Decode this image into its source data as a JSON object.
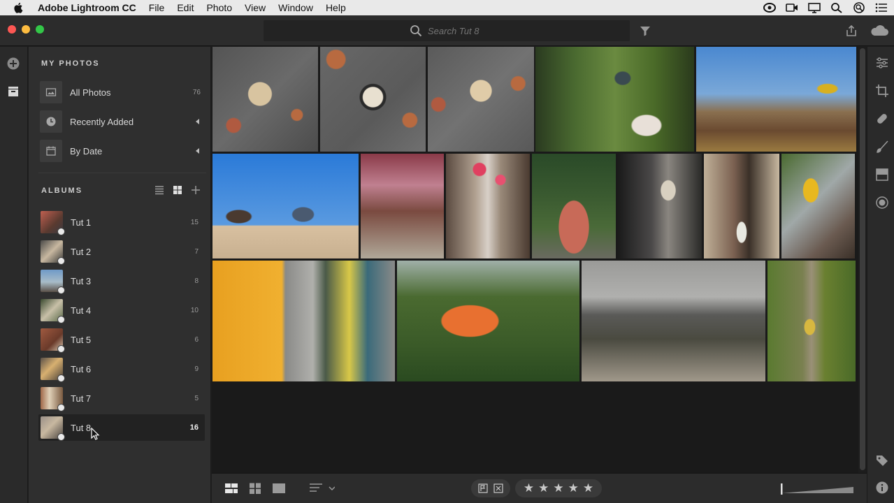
{
  "menubar": {
    "app_name": "Adobe Lightroom CC",
    "items": [
      "File",
      "Edit",
      "Photo",
      "View",
      "Window",
      "Help"
    ]
  },
  "search": {
    "placeholder": "Search Tut 8"
  },
  "sidebar": {
    "my_photos_title": "MY PHOTOS",
    "photos": [
      {
        "label": "All Photos",
        "count": "76",
        "icon": "image-icon"
      },
      {
        "label": "Recently Added",
        "count": "",
        "icon": "clock-icon"
      },
      {
        "label": "By Date",
        "count": "",
        "icon": "calendar-icon"
      }
    ],
    "albums_title": "ALBUMS",
    "albums": [
      {
        "label": "Tut 1",
        "count": "15",
        "color": "#8a5040"
      },
      {
        "label": "Tut 2",
        "count": "7",
        "color": "#6a6a68"
      },
      {
        "label": "Tut 3",
        "count": "8",
        "color": "#6f8ba8"
      },
      {
        "label": "Tut 4",
        "count": "10",
        "color": "#5a6a4a"
      },
      {
        "label": "Tut 5",
        "count": "6",
        "color": "#7a4a3a"
      },
      {
        "label": "Tut 6",
        "count": "9",
        "color": "#b08a5a"
      },
      {
        "label": "Tut 7",
        "count": "5",
        "color": "#8a6a50"
      },
      {
        "label": "Tut 8",
        "count": "16",
        "color": "#7a7068"
      }
    ],
    "selected_album": "Tut 8"
  },
  "colors": {
    "accent": "#2c2c2c",
    "traffic_red": "#fc5753",
    "traffic_yellow": "#fdbc40",
    "traffic_green": "#33c748"
  }
}
